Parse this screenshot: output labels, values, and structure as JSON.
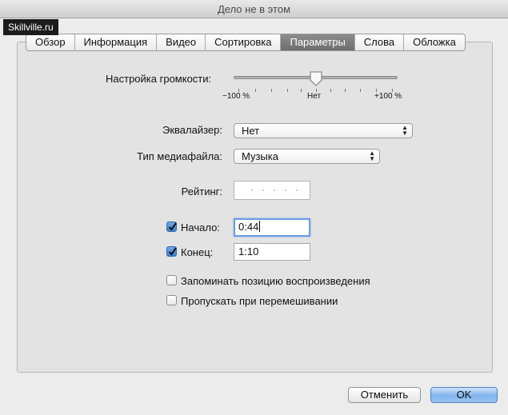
{
  "window": {
    "title": "Дело не в этом"
  },
  "watermark": "Skillville.ru",
  "tabs": [
    {
      "label": "Обзор",
      "active": false
    },
    {
      "label": "Информация",
      "active": false
    },
    {
      "label": "Видео",
      "active": false
    },
    {
      "label": "Сортировка",
      "active": false
    },
    {
      "label": "Параметры",
      "active": true
    },
    {
      "label": "Слова",
      "active": false
    },
    {
      "label": "Обложка",
      "active": false
    }
  ],
  "volume": {
    "label": "Настройка громкости:",
    "min_label": "−100 %",
    "mid_label": "Нет",
    "max_label": "+100 %",
    "value_percent": 0
  },
  "equalizer": {
    "label": "Эквалайзер:",
    "value": "Нет"
  },
  "media_type": {
    "label": "Тип медиафайла:",
    "value": "Музыка"
  },
  "rating": {
    "label": "Рейтинг:",
    "stars": 0
  },
  "start": {
    "label": "Начало:",
    "checked": true,
    "value": "0:44"
  },
  "stop": {
    "label": "Конец:",
    "checked": true,
    "value": "1:10"
  },
  "remember_position": {
    "label": "Запоминать позицию воспроизведения",
    "checked": false
  },
  "skip_shuffle": {
    "label": "Пропускать при перемешивании",
    "checked": false
  },
  "buttons": {
    "cancel": "Отменить",
    "ok": "OK"
  },
  "icons": {
    "checkmark": "checkmark-icon",
    "popup_arrows": "updown-arrows-icon",
    "slider_thumb": "slider-thumb-icon"
  }
}
